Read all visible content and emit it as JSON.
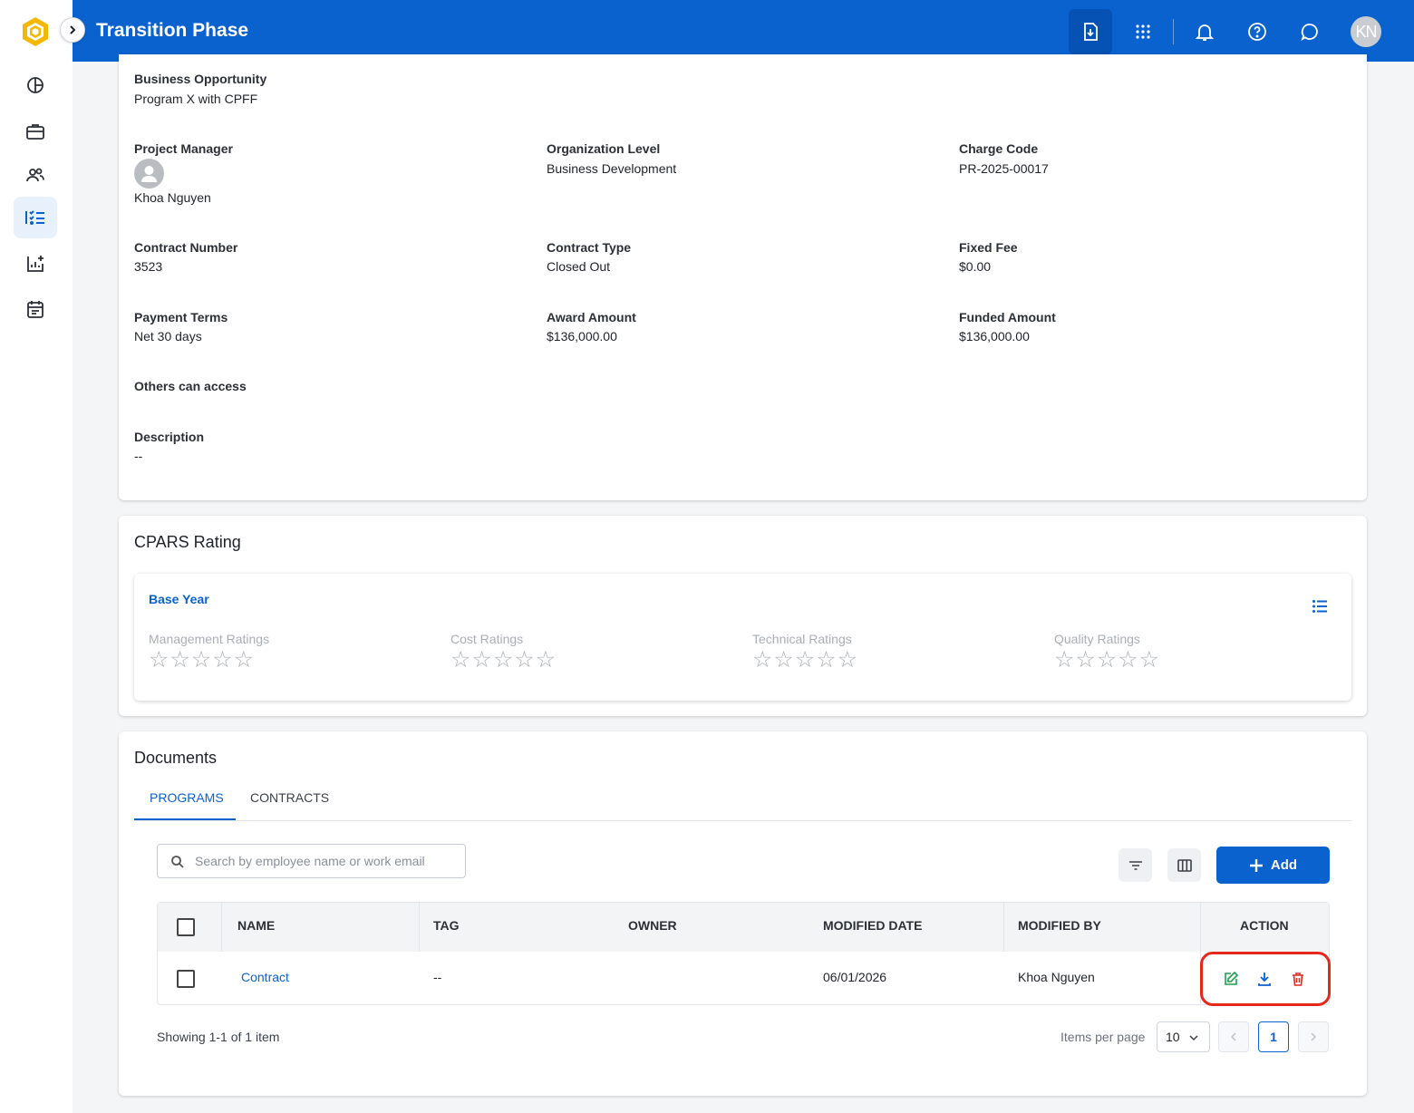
{
  "header": {
    "title": "Transition Phase",
    "user_initials": "KN",
    "icons": [
      "download-doc-icon",
      "apps-grid-icon",
      "bell-icon",
      "help-icon",
      "chat-icon"
    ]
  },
  "sidebar": {
    "items": [
      {
        "icon": "dashboard-icon"
      },
      {
        "icon": "briefcase-icon"
      },
      {
        "icon": "people-icon"
      },
      {
        "icon": "task-list-icon",
        "active": true
      },
      {
        "icon": "chart-add-icon"
      },
      {
        "icon": "calendar-icon"
      }
    ]
  },
  "details": {
    "business_opportunity": {
      "label": "Business Opportunity",
      "value": "Program X with CPFF"
    },
    "project_manager": {
      "label": "Project Manager",
      "value": "Khoa Nguyen"
    },
    "organization_level": {
      "label": "Organization Level",
      "value": "Business Development"
    },
    "charge_code": {
      "label": "Charge Code",
      "value": "PR-2025-00017"
    },
    "contract_number": {
      "label": "Contract Number",
      "value": "3523"
    },
    "contract_type": {
      "label": "Contract Type",
      "value": "Closed Out"
    },
    "fixed_fee": {
      "label": "Fixed Fee",
      "value": "$0.00"
    },
    "payment_terms": {
      "label": "Payment Terms",
      "value": "Net 30 days"
    },
    "award_amount": {
      "label": "Award Amount",
      "value": "$136,000.00"
    },
    "funded_amount": {
      "label": "Funded Amount",
      "value": "$136,000.00"
    },
    "others_access": {
      "label": "Others can access"
    },
    "description": {
      "label": "Description",
      "value": "--"
    }
  },
  "cpars": {
    "title": "CPARS Rating",
    "period": "Base Year",
    "ratings": [
      {
        "label": "Management Ratings",
        "stars": "☆☆☆☆☆",
        "value": 0
      },
      {
        "label": "Cost Ratings",
        "stars": "☆☆☆☆☆",
        "value": 0
      },
      {
        "label": "Technical Ratings",
        "stars": "☆☆☆☆☆",
        "value": 0
      },
      {
        "label": "Quality Ratings",
        "stars": "☆☆☆☆☆",
        "value": 0
      }
    ]
  },
  "documents": {
    "title": "Documents",
    "tabs": [
      "PROGRAMS",
      "CONTRACTS"
    ],
    "active_tab": "PROGRAMS",
    "search_placeholder": "Search by employee name or work email",
    "add_label": "Add",
    "columns": [
      "NAME",
      "TAG",
      "OWNER",
      "MODIFIED DATE",
      "MODIFIED BY",
      "ACTION"
    ],
    "rows": [
      {
        "name": "Contract",
        "tag": "--",
        "owner": "",
        "modified_date": "06/01/2026",
        "modified_by": "Khoa Nguyen"
      }
    ],
    "showing": "Showing 1-1 of 1 item",
    "items_per_page_label": "Items per page",
    "items_per_page": "10",
    "current_page": "1"
  },
  "colors": {
    "primary": "#0a62cf",
    "edit": "#1e9e4a",
    "delete": "#d92d20",
    "highlight": "#e8271b"
  }
}
